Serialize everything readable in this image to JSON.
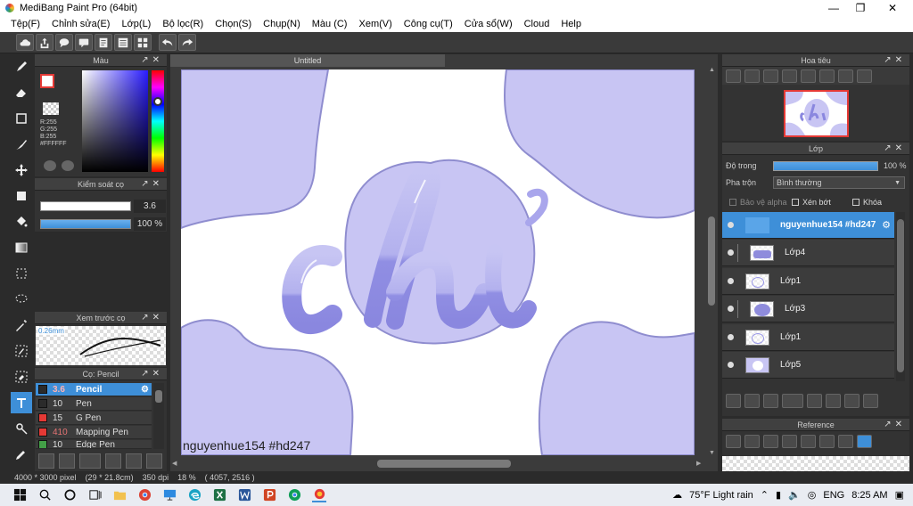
{
  "window": {
    "title": "MediBang Paint Pro (64bit)"
  },
  "menu": [
    "Tệp(F)",
    "Chỉnh sửa(E)",
    "Lớp(L)",
    "Bộ lọc(R)",
    "Chọn(S)",
    "Chụp(N)",
    "Màu (C)",
    "Xem(V)",
    "Công cụ(T)",
    "Cửa sổ(W)",
    "Cloud",
    "Help"
  ],
  "color_panel": {
    "title": "Màu",
    "r": "R:255",
    "g": "G:255",
    "b": "B:255",
    "hex": "#FFFFFF"
  },
  "brush_control": {
    "title": "Kiểm soát cọ",
    "size": "3.6",
    "opacity": "100 %",
    "size_fill": 0.88,
    "opacity_fill": 1.0
  },
  "brush_preview": {
    "title": "Xem trước cọ",
    "size": "0.26mm"
  },
  "brush_list": {
    "title": "Cọ: Pencil",
    "items": [
      {
        "num": "3.6",
        "name": "Pencil",
        "color": "#2b2b2b",
        "selected": true
      },
      {
        "num": "10",
        "name": "Pen",
        "color": "#2b2b2b",
        "selected": false
      },
      {
        "num": "15",
        "name": "G Pen",
        "color": "#e53935",
        "selected": false
      },
      {
        "num": "410",
        "name": "Mapping Pen",
        "color": "#e53935",
        "selected": false
      },
      {
        "num": "10",
        "name": "Edge Pen",
        "color": "#43a047",
        "selected": false
      }
    ]
  },
  "canvas": {
    "tab": "Untitled",
    "watermark": "nguyenhue154  #hd247",
    "art_text": "chỉ"
  },
  "navigator": {
    "title": "Hoa tiêu"
  },
  "layers": {
    "title": "Lớp",
    "opacity_label": "Độ trong",
    "opacity_value": "100 %",
    "opacity_fill": 1.0,
    "blend_label": "Pha trộn",
    "blend_value": "Bình thường",
    "protect_alpha": "Bảo vệ alpha",
    "clipping": "Xén bớt",
    "lock": "Khóa",
    "items": [
      {
        "name": "nguyenhue154   #hd247",
        "selected": true,
        "indent": false
      },
      {
        "name": "Lớp4",
        "selected": false,
        "indent": true
      },
      {
        "name": "Lớp1",
        "selected": false,
        "indent": false
      },
      {
        "name": "Lớp3",
        "selected": false,
        "indent": true
      },
      {
        "name": "Lớp1",
        "selected": false,
        "indent": false
      },
      {
        "name": "Lớp5",
        "selected": false,
        "indent": false
      }
    ]
  },
  "reference": {
    "title": "Reference"
  },
  "status": {
    "size": "4000 * 3000 pixel",
    "physical": "(29 * 21.8cm)",
    "dpi": "350 dpi",
    "zoom": "18 %",
    "coords": "( 4057, 2516 )"
  },
  "taskbar": {
    "weather": "75°F  Light rain",
    "lang": "ENG",
    "time": "8:25 AM"
  },
  "colors": {
    "accent": "#3e8fd8",
    "blob": "#c8c5f3",
    "letter": "#9a98e6"
  }
}
